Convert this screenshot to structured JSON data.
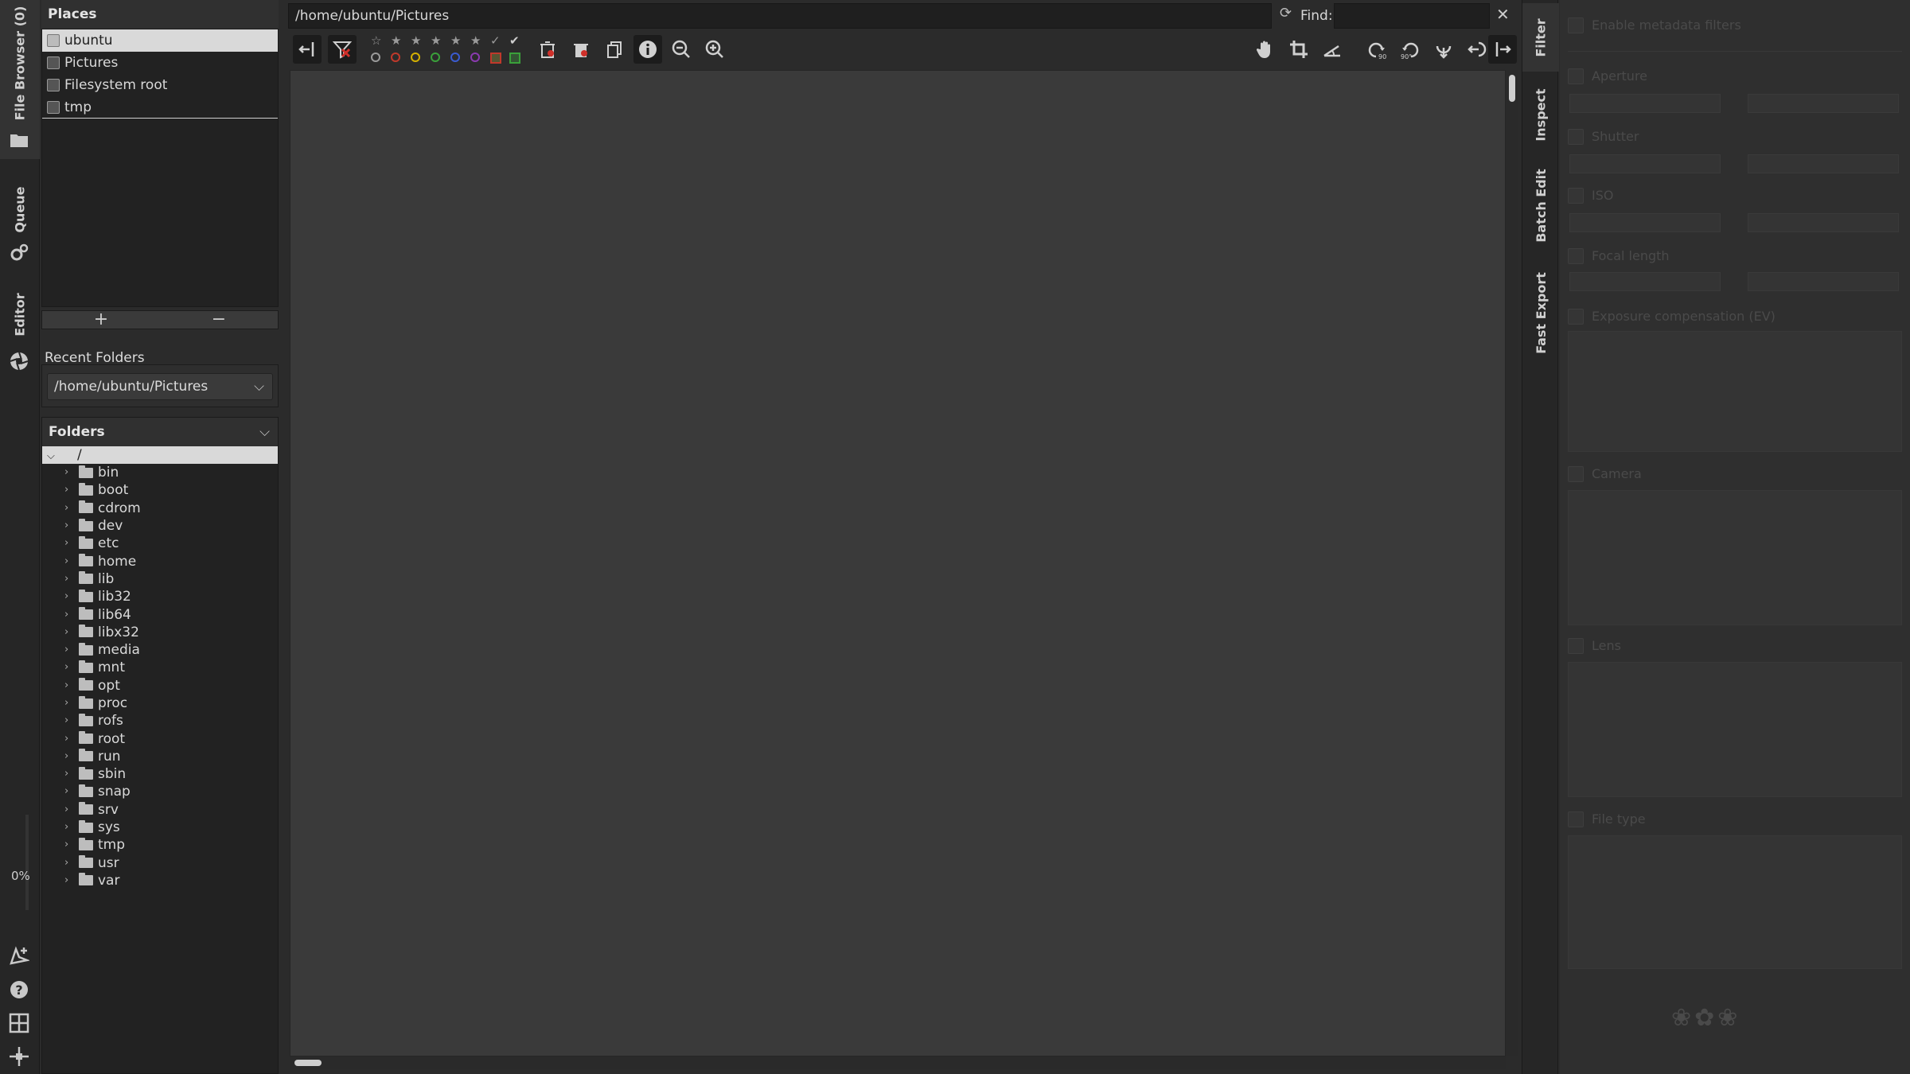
{
  "left_tabs": {
    "file_browser": "File Browser (0)",
    "queue": "Queue",
    "editor": "Editor",
    "progress": "0%"
  },
  "places": {
    "title": "Places",
    "items": [
      {
        "label": "ubuntu"
      },
      {
        "label": "Pictures"
      },
      {
        "label": "Filesystem root"
      },
      {
        "label": "tmp"
      }
    ],
    "add": "+",
    "remove": "−"
  },
  "recent": {
    "label": "Recent Folders",
    "value": "/home/ubuntu/Pictures"
  },
  "folders": {
    "title": "Folders",
    "root": "/",
    "items": [
      "bin",
      "boot",
      "cdrom",
      "dev",
      "etc",
      "home",
      "lib",
      "lib32",
      "lib64",
      "libx32",
      "media",
      "mnt",
      "opt",
      "proc",
      "rofs",
      "root",
      "run",
      "sbin",
      "snap",
      "srv",
      "sys",
      "tmp",
      "usr",
      "var"
    ]
  },
  "browser": {
    "path": "/home/ubuntu/Pictures",
    "find_label": "Find:",
    "find_value": ""
  },
  "right_tabs": [
    "Filter",
    "Inspect",
    "Batch Edit",
    "Fast Export"
  ],
  "filter": {
    "enable": "Enable metadata filters",
    "aperture": "Aperture",
    "shutter": "Shutter",
    "iso": "ISO",
    "focal": "Focal length",
    "exposure_comp": "Exposure compensation (EV)",
    "camera": "Camera",
    "lens": "Lens",
    "filetype": "File type"
  },
  "colors": {
    "accent_red": "#d0302a",
    "label_red": "#c0392b",
    "label_yellow": "#d4b000",
    "label_green": "#3aa03a",
    "label_blue": "#3a5bd0",
    "label_purple": "#8a3ab0"
  }
}
